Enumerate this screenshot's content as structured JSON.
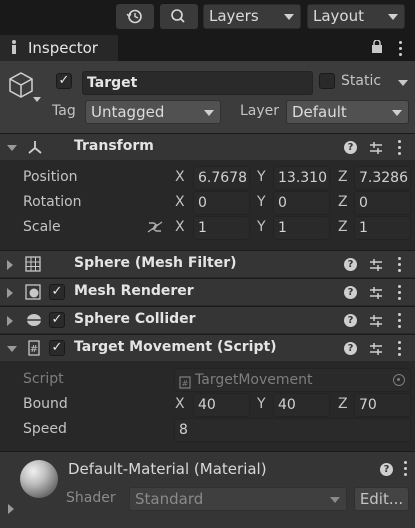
{
  "toolbar": {
    "layers_label": "Layers",
    "layout_label": "Layout"
  },
  "tab": {
    "label": "Inspector"
  },
  "object": {
    "name": "Target",
    "static_label": "Static",
    "tag_label": "Tag",
    "tag_value": "Untagged",
    "layer_label": "Layer",
    "layer_value": "Default"
  },
  "transform": {
    "title": "Transform",
    "position_label": "Position",
    "rotation_label": "Rotation",
    "scale_label": "Scale",
    "position": {
      "x": "6.7678",
      "y": "13.310",
      "z": "7.3286"
    },
    "rotation": {
      "x": "0",
      "y": "0",
      "z": "0"
    },
    "scale": {
      "x": "1",
      "y": "1",
      "z": "1"
    },
    "axis": {
      "x": "X",
      "y": "Y",
      "z": "Z"
    }
  },
  "components": {
    "mesh_filter": "Sphere (Mesh Filter)",
    "mesh_renderer": "Mesh Renderer",
    "sphere_collider": "Sphere Collider",
    "target_movement": "Target Movement (Script)"
  },
  "script": {
    "script_label": "Script",
    "script_value": "TargetMovement",
    "bound_label": "Bound",
    "bound": {
      "x": "40",
      "y": "40",
      "z": "70"
    },
    "speed_label": "Speed",
    "speed_value": "8"
  },
  "material": {
    "title": "Default-Material (Material)",
    "shader_label": "Shader",
    "shader_value": "Standard",
    "edit_label": "Edit..."
  },
  "colors": {
    "background": "#1e1e1e",
    "header": "#353535",
    "field": "#2a2a2a"
  }
}
